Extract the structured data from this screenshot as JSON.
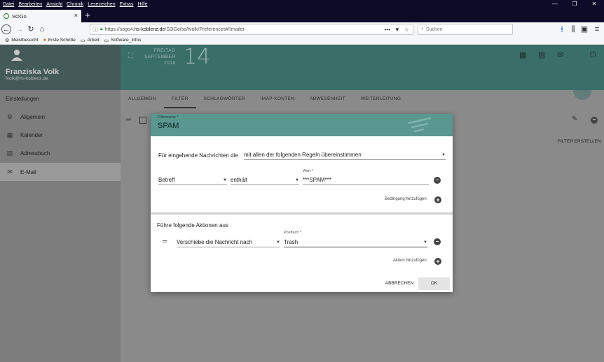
{
  "browser": {
    "menu": [
      "Datei",
      "Bearbeiten",
      "Ansicht",
      "Chronik",
      "Lesezeichen",
      "Extras",
      "Hilfe"
    ],
    "tab_title": "SOGo",
    "url_prefix": "https://sogo4.",
    "url_domain": "hs-koblenz.de",
    "url_path": "/SOGo/so/fvolk/Preferences#!/mailer",
    "url_more": "•••",
    "search_placeholder": "Suchen",
    "bookmarks": [
      {
        "label": "Meistbesucht",
        "icon": "gear-icon"
      },
      {
        "label": "Erste Schritte",
        "icon": "firefox-icon"
      },
      {
        "label": "Arbeit",
        "icon": "folder-icon"
      },
      {
        "label": "Software_Infos",
        "icon": "folder-icon"
      }
    ]
  },
  "header": {
    "user_name": "Franziska Volk",
    "user_email": "fvolk@hs-koblenz.de",
    "date_weekday": "FREITAG",
    "date_month": "SEPTEMBER",
    "date_year": "2018",
    "date_day": "14"
  },
  "sidebar": {
    "title": "Einstellungen",
    "items": [
      {
        "label": "Allgemein",
        "icon": "gear-icon"
      },
      {
        "label": "Kalender",
        "icon": "calendar-icon"
      },
      {
        "label": "Adressbuch",
        "icon": "contacts-icon"
      },
      {
        "label": "E-Mail",
        "icon": "mail-icon"
      }
    ]
  },
  "tabs": [
    "ALLGEMEIN",
    "FILTER",
    "SCHLAGWÖRTER",
    "IMAP-KONTEN",
    "ABWESENHEIT",
    "WEITERLEITUNG"
  ],
  "active_tab": "FILTER",
  "filter_create": "FILTER ERSTELLEN",
  "dialog": {
    "filtername_label": "Filtername *",
    "filtername_value": "SPAM",
    "match_prefix": "Für eingehende Nachrichten die",
    "match_value": "mit allen der folgenden Regeln übereinstimmen",
    "condition": {
      "field": "Betreff",
      "operator": "enthält",
      "value_label": "Wert *",
      "value": "***SPAM***"
    },
    "add_condition": "Bedingung hinzufügen",
    "actions_title": "Führe folgende Aktionen aus",
    "action": {
      "type": "Verschiebe die Nachricht nach",
      "folder_label": "Postfach *",
      "folder": "Trash"
    },
    "add_action": "Aktion hinzufügen",
    "cancel": "ABBRECHEN",
    "ok": "OK"
  },
  "colors": {
    "header_teal": "#3a6e69",
    "dialog_header": "#5a9790",
    "overlay_gray": "#8a8a8a"
  }
}
